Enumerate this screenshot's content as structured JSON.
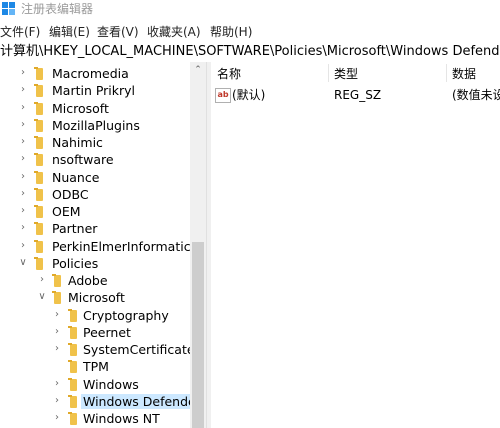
{
  "window": {
    "title": "注册表编辑器"
  },
  "menu": [
    "文件(F)",
    "编辑(E)",
    "查看(V)",
    "收藏夹(A)",
    "帮助(H)"
  ],
  "address": {
    "path": "计算机\\HKEY_LOCAL_MACHINE\\SOFTWARE\\Policies\\Microsoft\\Windows Defender"
  },
  "tree": {
    "items": [
      {
        "label": "Macromedia",
        "level": 0,
        "expander": "collapsed"
      },
      {
        "label": "Martin Prikryl",
        "level": 0,
        "expander": "collapsed"
      },
      {
        "label": "Microsoft",
        "level": 0,
        "expander": "collapsed"
      },
      {
        "label": "MozillaPlugins",
        "level": 0,
        "expander": "collapsed"
      },
      {
        "label": "Nahimic",
        "level": 0,
        "expander": "collapsed"
      },
      {
        "label": "nsoftware",
        "level": 0,
        "expander": "collapsed"
      },
      {
        "label": "Nuance",
        "level": 0,
        "expander": "collapsed"
      },
      {
        "label": "ODBC",
        "level": 0,
        "expander": "collapsed"
      },
      {
        "label": "OEM",
        "level": 0,
        "expander": "collapsed"
      },
      {
        "label": "Partner",
        "level": 0,
        "expander": "collapsed"
      },
      {
        "label": "PerkinElmerInformatics",
        "level": 0,
        "expander": "collapsed"
      },
      {
        "label": "Policies",
        "level": 0,
        "expander": "expanded"
      },
      {
        "label": "Adobe",
        "level": 1,
        "expander": "collapsed"
      },
      {
        "label": "Microsoft",
        "level": 1,
        "expander": "expanded"
      },
      {
        "label": "Cryptography",
        "level": 2,
        "expander": "collapsed"
      },
      {
        "label": "Peernet",
        "level": 2,
        "expander": "collapsed"
      },
      {
        "label": "SystemCertificates",
        "level": 2,
        "expander": "collapsed"
      },
      {
        "label": "TPM",
        "level": 2,
        "expander": "none"
      },
      {
        "label": "Windows",
        "level": 2,
        "expander": "collapsed"
      },
      {
        "label": "Windows Defende",
        "level": 2,
        "expander": "collapsed",
        "selected": true
      },
      {
        "label": "Windows NT",
        "level": 2,
        "expander": "collapsed"
      }
    ]
  },
  "list": {
    "columns": [
      "名称",
      "类型",
      "数据"
    ],
    "rows": [
      {
        "icon": "ab",
        "name": "(默认)",
        "type": "REG_SZ",
        "data": "(数值未设"
      }
    ]
  },
  "colors": {
    "selection": "#cce8ff",
    "folder": "#f0c24a",
    "scrollbar_thumb": "#cdcdcd"
  }
}
